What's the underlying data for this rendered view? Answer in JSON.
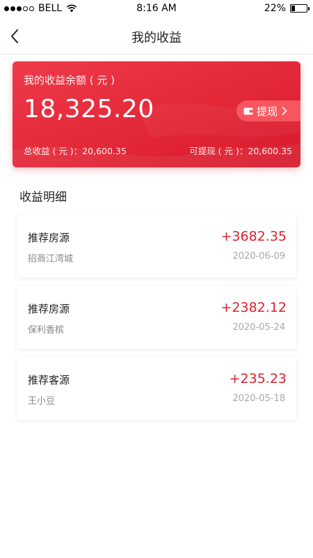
{
  "status_bar": {
    "carrier": "BELL",
    "time": "8:16 AM",
    "battery": "22%",
    "battery_level": 0.22
  },
  "nav": {
    "title": "我的收益"
  },
  "balance": {
    "label": "我的收益余额 ( 元 )",
    "amount": "18,325.20",
    "withdraw_label": "提现",
    "total_label": "总收益 ( 元 )：",
    "total_value": "20,600.35",
    "withdrawable_label": "可提现 ( 元 )：",
    "withdrawable_value": "20,600.35",
    "accent_color": "#e22636"
  },
  "details": {
    "title": "收益明细",
    "items": [
      {
        "type": "推荐房源",
        "name": "招商江湾城",
        "amount": "+3682.35",
        "date": "2020-06-09"
      },
      {
        "type": "推荐房源",
        "name": "保利香槟",
        "amount": "+2382.12",
        "date": "2020-05-24"
      },
      {
        "type": "推荐客源",
        "name": "王小豆",
        "amount": "+235.23",
        "date": "2020-05-18"
      }
    ]
  }
}
